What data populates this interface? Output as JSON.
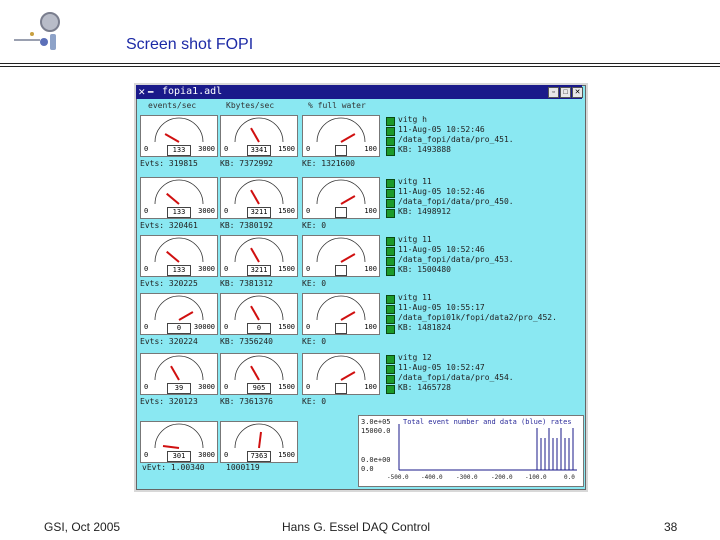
{
  "slide": {
    "title": "Screen shot FOPI",
    "footer_left": "GSI, Oct 2005",
    "footer_center": "Hans G. Essel DAQ Control",
    "footer_right": "38"
  },
  "window": {
    "title": "fopia1.adl",
    "menu_glyph": "✕ ━"
  },
  "columns": [
    "events/sec",
    "Kbytes/sec",
    "% full water"
  ],
  "rows": [
    {
      "m1_value": "133",
      "m1_min": "0",
      "m1_max": "3000",
      "m2_value": "3341",
      "m2_min": "0",
      "m2_max": "1500",
      "m3_min": "0",
      "m3_max": "100",
      "events": "Evts: 319815",
      "kbytes": "KB: 7372992",
      "ke": "KE: 1321600",
      "info": [
        "vitg h",
        "11-Aug-05 10:52:46",
        "/data_fopi/data/pro_451.",
        "KB: 1493888"
      ]
    },
    {
      "m1_value": "133",
      "m1_min": "0",
      "m1_max": "3000",
      "m2_value": "3211",
      "m2_min": "0",
      "m2_max": "1500",
      "m3_min": "0",
      "m3_max": "100",
      "events": "Evts: 320461",
      "kbytes": "KB: 7380192",
      "ke": "KE: 0",
      "info": [
        "vitg 11",
        "11-Aug-05 10:52:46",
        "/data_fopi/data/pro_450.",
        "KB: 1498912"
      ]
    },
    {
      "m1_value": "133",
      "m1_min": "0",
      "m1_max": "3000",
      "m2_value": "3211",
      "m2_min": "0",
      "m2_max": "1500",
      "m3_min": "0",
      "m3_max": "100",
      "events": "Evts: 320225",
      "kbytes": "KB: 7381312",
      "ke": "KE: 0",
      "info": [
        "vitg 11",
        "11-Aug-05 10:52:46",
        "/data_fopi/data/pro_453.",
        "KB: 1500480"
      ]
    },
    {
      "m1_value": "0",
      "m1_min": "0",
      "m1_max": "30000",
      "m2_value": "0",
      "m2_min": "0",
      "m2_max": "1500",
      "m3_min": "0",
      "m3_max": "100",
      "events": "Evts: 320224",
      "kbytes": "KB: 7356240",
      "ke": "KE: 0",
      "info": [
        "vitg 11",
        "11-Aug-05 10:55:17",
        "/data_fopi01k/fopi/data2/pro_452.",
        "KB: 1481824"
      ]
    },
    {
      "m1_value": "39",
      "m1_min": "0",
      "m1_max": "3000",
      "m2_value": "905",
      "m2_min": "0",
      "m2_max": "1500",
      "m3_min": "0",
      "m3_max": "100",
      "events": "Evts: 320123",
      "kbytes": "KB: 7361376",
      "ke": "KE: 0",
      "info": [
        "vitg 12",
        "11-Aug-05 10:52:47",
        "/data_fopi/data/pro_454.",
        "KB: 1465728"
      ]
    }
  ],
  "total": {
    "m1_value": "301",
    "m1_min": "0",
    "m1_max": "3000",
    "m2_value": "7363",
    "m2_min": "0",
    "m2_max": "1500",
    "events": "vEvt: 1.00340",
    "kbytes": "1000119"
  },
  "chart_data": {
    "type": "line",
    "title": "Total event number and data (blue) rates",
    "y_labels": [
      "3.0e+05",
      "15000.0",
      "0.0e+00",
      "0.0"
    ],
    "x_ticks": [
      "-500.0",
      "-400.0",
      "-300.0",
      "-200.0",
      "-100.0",
      "0.0"
    ],
    "xlim": [
      -500,
      0
    ]
  },
  "colors": {
    "panel": "#8ae8f2",
    "led": "#1c9a2a",
    "needle": "#d01010",
    "title": "#1c2aa6",
    "titlebar": "#1a1a8a"
  }
}
